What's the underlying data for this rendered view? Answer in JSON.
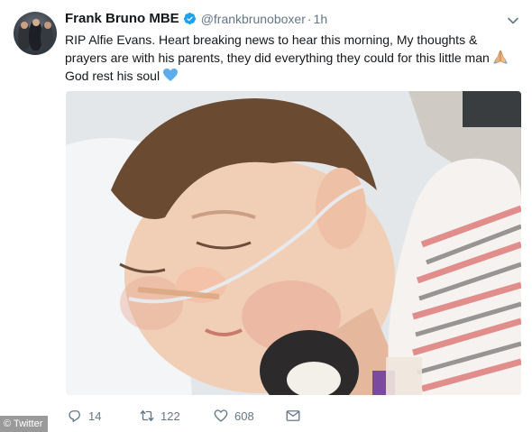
{
  "tweet": {
    "author_name": "Frank Bruno MBE",
    "handle": "@frankbrunoboxer",
    "separator": "·",
    "time": "1h",
    "text_lines": [
      "RIP Alfie Evans.  Heart breaking news to hear this morning, My thoughts &",
      "prayers are with his parents, they did everything they could for this little man",
      "God rest his soul"
    ],
    "emojis": [
      "folded-hands-emoji",
      "blue-heart-emoji"
    ]
  },
  "actions": {
    "reply_count": "14",
    "retweet_count": "122",
    "like_count": "608"
  },
  "watermark": "© Twitter",
  "colors": {
    "text": "#14171a",
    "secondary": "#657786",
    "verified": "#1da1f2",
    "heart": "#5dadec"
  }
}
